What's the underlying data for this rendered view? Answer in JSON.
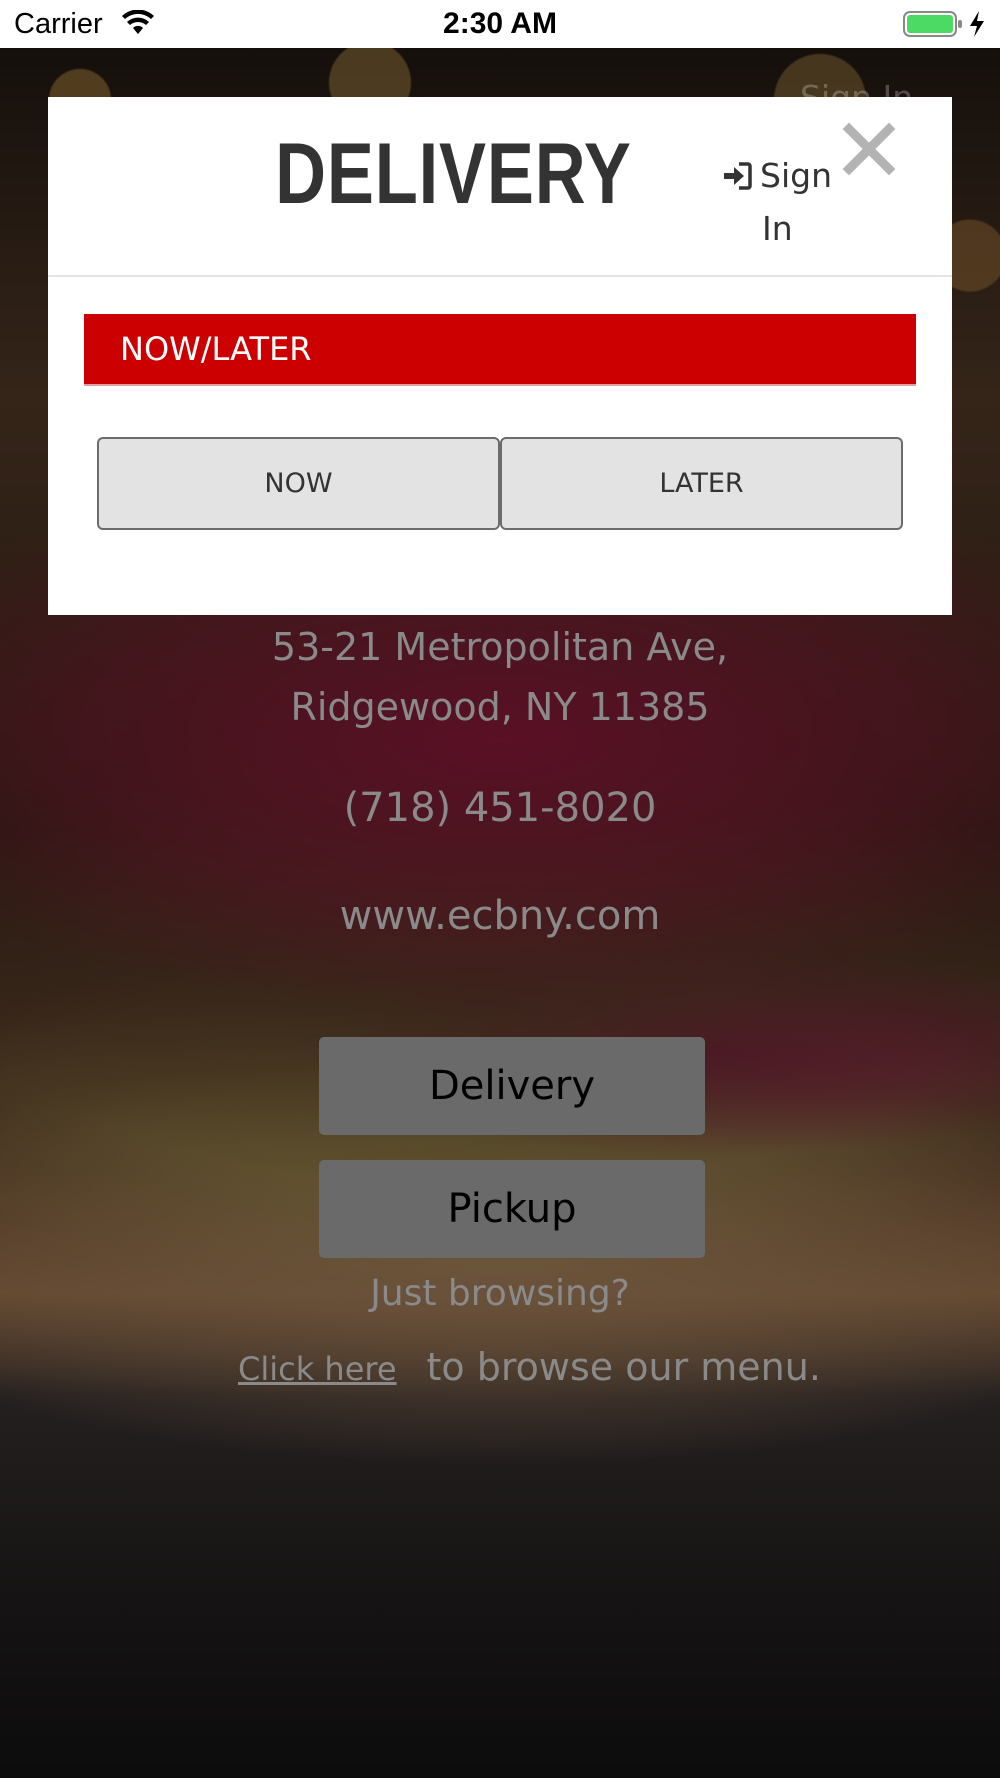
{
  "status_bar": {
    "carrier": "Carrier",
    "time": "2:30 AM",
    "battery_color": "#4cd964"
  },
  "background": {
    "sign_in": "Sign In",
    "address_line1": "53-21 Metropolitan Ave,",
    "address_line2": "Ridgewood, NY 11385",
    "phone": "(718) 451-8020",
    "website": "www.ecbny.com",
    "delivery_button": "Delivery",
    "pickup_button": "Pickup",
    "browsing_prompt": "Just browsing?",
    "click_here_link": "Click here",
    "browse_text": "to browse our menu."
  },
  "modal": {
    "title": "DELIVERY",
    "sign_in_word1": "Sign",
    "sign_in_word2": "In",
    "section_label": "NOW/LATER",
    "section_color": "#cc0000",
    "now_button": "NOW",
    "later_button": "LATER",
    "icons": {
      "sign_in": "sign-in-icon",
      "close": "close-icon"
    }
  }
}
